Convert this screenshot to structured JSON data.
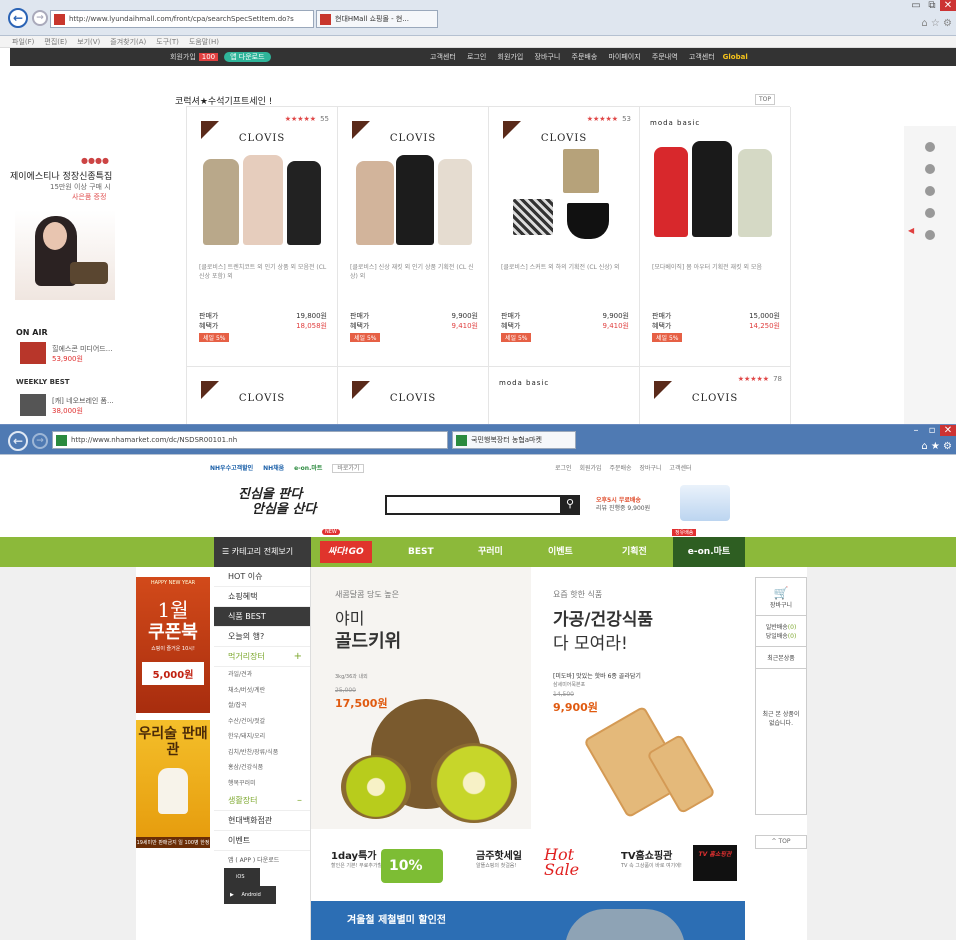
{
  "w1": {
    "url": "http://www.lyundaihmall.com/front/cpa/searchSpecSetItem.do?s",
    "tab1": "현대HMall 쇼핑몰 - 현...",
    "tab2": "",
    "menubar": [
      "파일(F)",
      "편집(E)",
      "보기(V)",
      "즐겨찾기(A)",
      "도구(T)",
      "도움말(H)"
    ],
    "blackbar": {
      "left": "회원가입",
      "badge": "100",
      "app": "앱 다운로드",
      "right": "고객센터 로그인 회원가입 장바구니 주문배송 마이페이지 주문내역 고객센터",
      "global": "Global"
    },
    "left": {
      "dots": "●●●●",
      "title": "제이에스티나 정장신종특집",
      "sub": "15만원 이상 구매 시",
      "link": "사은품 증정",
      "onair": "ON AIR",
      "onair_item": {
        "name": "힐에스콘 미디어드...",
        "price": "53,900원"
      },
      "weekly": "WEEKLY BEST",
      "weekly_item": {
        "name": "[캐] 네오브레인 폼...",
        "price": "38,000원"
      }
    },
    "section_title": "코럭셔★수석기프트세인 !",
    "top": "TOP",
    "products": [
      {
        "stars": "★★★★★",
        "count": "55",
        "brand": "CLOVIS",
        "desc": "[클로비스] 트렌치코트 외 인기 상품 외 모음전 (CL 신상 포함) 외",
        "price_label": "판매가",
        "price": "19,800원",
        "sale_label": "혜택가",
        "sale": "18,058원",
        "dc": "세일 5%"
      },
      {
        "stars": "",
        "count": "",
        "brand": "CLOVIS",
        "desc": "[클로비스] 신상 재킷 외 인기 상품 기획전 (CL 신상) 외",
        "price_label": "판매가",
        "price": "9,900원",
        "sale_label": "혜택가",
        "sale": "9,410원",
        "dc": "세일 5%"
      },
      {
        "stars": "★★★★★",
        "count": "53",
        "brand": "CLOVIS",
        "desc": "[클로비스] 스커트 외 하의 기획전 (CL 신상) 외",
        "price_label": "판매가",
        "price": "9,900원",
        "sale_label": "혜택가",
        "sale": "9,410원",
        "dc": "세일 5%"
      },
      {
        "stars": "",
        "count": "",
        "brand": "moda basic",
        "desc": "[모다베이직] 봄 아우터 기획전 재킷 외 모음",
        "price_label": "판매가",
        "price": "15,000원",
        "sale_label": "혜택가",
        "sale": "14,250원",
        "dc": "세일 5%"
      },
      {
        "stars": "",
        "count": "",
        "brand": "CLOVIS",
        "desc": "",
        "price_label": "",
        "price": "",
        "sale_label": "",
        "sale": "",
        "dc": ""
      },
      {
        "stars": "",
        "count": "",
        "brand": "CLOVIS",
        "desc": "",
        "price_label": "",
        "price": "",
        "sale_label": "",
        "sale": "",
        "dc": ""
      },
      {
        "stars": "",
        "count": "",
        "brand": "moda basic",
        "desc": "",
        "price_label": "",
        "price": "",
        "sale_label": "",
        "sale": "",
        "dc": ""
      },
      {
        "stars": "★★★★★",
        "count": "78",
        "brand": "CLOVIS",
        "desc": "",
        "price_label": "",
        "price": "",
        "sale_label": "",
        "sale": "",
        "dc": ""
      }
    ]
  },
  "w2": {
    "url": "http://www.nhamarket.com/dc/NSDSR00101.nh",
    "tab": "국민행복장터 농협a마켓",
    "gnb": {
      "nh1": "NH우수고객할인",
      "nh2": "NH채움",
      "eon": "e-on.마트",
      "goto": "바로가기",
      "util": "로그인 회원가입 주문배송 장바구니 고객센터"
    },
    "logo1": "진심을 판다",
    "logo2": "안심을 산다",
    "freeship_hl": "오후5시 무료배송",
    "freeship": "리뷰 진행중 9,900원",
    "catbtn": "카테고리 전체보기",
    "nav": [
      {
        "label": "싸다!GO"
      },
      {
        "label": "BEST"
      },
      {
        "label": "꾸러미"
      },
      {
        "label": "이벤트"
      },
      {
        "label": "기획전"
      }
    ],
    "new_tag": "NEW",
    "emart_tag": "정유배송",
    "emart": "e-on.마트",
    "menu": {
      "items": [
        "HOT 이슈",
        "쇼핑혜택",
        "식품 BEST",
        "오늘의 행?"
      ],
      "sec1": "먹거리장터",
      "subs": [
        "과일/견과",
        "채소/버섯/계란",
        "쌀/잡곡",
        "수산/건어/젓갈",
        "한우/돼지/오리",
        "김치/반찬/장류/식품",
        "홍삼/건강식품",
        "행복꾸러미"
      ],
      "sec2": "생활장터",
      "items2": [
        "현대백화점관",
        "이벤트"
      ],
      "app": "앱 ( APP ) 다운로드",
      "ios": "iOS",
      "android": "Android"
    },
    "banner1": {
      "hny": "HAPPY NEW YEAR",
      "month": "1월",
      "coupon": "쿠폰북",
      "sub": "쇼핑이 즐거운 10시!",
      "price": "5,000원"
    },
    "banner2": {
      "title": "우리술 판매관",
      "foot": "19세미만 판매금지 일 100병 한정"
    },
    "hero1": {
      "sub": "새콤달콤 당도 높은",
      "t1": "야미",
      "t2": "골드키위",
      "note": "3kg/36과 내외",
      "old": "25,000",
      "new": "17,500원"
    },
    "hero2": {
      "sub": "요즘 핫한 식품",
      "t1": "가공/건강식품",
      "t2": "다 모여라!",
      "p": "[미도바] 맛있는 핫바 6종 골라담기",
      "brand": "삼세미어묵본포",
      "old": "14,500",
      "new": "9,900원"
    },
    "cart": {
      "title": "장바구니",
      "a": "일반배송",
      "a_n": "(0)",
      "b": "당일배송",
      "b_n": "(0)",
      "recent": "최근본상품",
      "empty": "최근 본 상품이 없습니다."
    },
    "top": "TOP",
    "promos": [
      {
        "title": "1day특가",
        "desc": "할인은 기본! 무료추가할인!",
        "badge": "10%"
      },
      {
        "title": "금주핫세일",
        "desc": "알뜰쇼핑의 첫걸음!",
        "badge": "Hot Sale"
      },
      {
        "title": "TV홈쇼핑관",
        "desc": "TV 속 그상품이 바로 여기에!",
        "badge": "TV 홈쇼핑관"
      }
    ],
    "bottom": "겨울철 제철별미 할인전"
  }
}
